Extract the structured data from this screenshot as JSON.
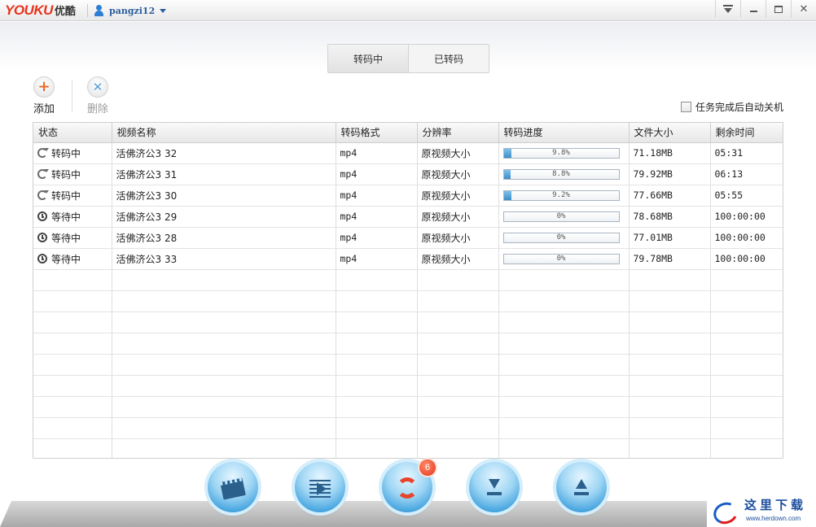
{
  "titlebar": {
    "logo_text": "YOUKU",
    "logo_cn": "优酷",
    "username": "pangzi12"
  },
  "tabs": [
    {
      "label": "转码中",
      "active": true
    },
    {
      "label": "已转码",
      "active": false
    }
  ],
  "toolbar": {
    "add_label": "添加",
    "delete_label": "删除",
    "auto_shutdown_label": "任务完成后自动关机",
    "auto_shutdown_checked": false
  },
  "table": {
    "headers": [
      "状态",
      "视频名称",
      "转码格式",
      "分辨率",
      "转码进度",
      "文件大小",
      "剩余时间"
    ],
    "rows": [
      {
        "status": "转码中",
        "status_icon": "refresh-icon",
        "name": "活佛济公3 32",
        "format": "mp4",
        "resolution": "原视频大小",
        "progress": 9.8,
        "progress_text": "9.8%",
        "size": "71.18MB",
        "remaining": "05:31"
      },
      {
        "status": "转码中",
        "status_icon": "refresh-icon",
        "name": "活佛济公3 31",
        "format": "mp4",
        "resolution": "原视频大小",
        "progress": 8.8,
        "progress_text": "8.8%",
        "size": "79.92MB",
        "remaining": "06:13"
      },
      {
        "status": "转码中",
        "status_icon": "refresh-icon",
        "name": "活佛济公3 30",
        "format": "mp4",
        "resolution": "原视频大小",
        "progress": 9.2,
        "progress_text": "9.2%",
        "size": "77.66MB",
        "remaining": "05:55"
      },
      {
        "status": "等待中",
        "status_icon": "clock-icon",
        "name": "活佛济公3 29",
        "format": "mp4",
        "resolution": "原视频大小",
        "progress": 0,
        "progress_text": "0%",
        "size": "78.68MB",
        "remaining": "100:00:00"
      },
      {
        "status": "等待中",
        "status_icon": "clock-icon",
        "name": "活佛济公3 28",
        "format": "mp4",
        "resolution": "原视频大小",
        "progress": 0,
        "progress_text": "0%",
        "size": "77.01MB",
        "remaining": "100:00:00"
      },
      {
        "status": "等待中",
        "status_icon": "clock-icon",
        "name": "活佛济公3 33",
        "format": "mp4",
        "resolution": "原视频大小",
        "progress": 0,
        "progress_text": "0%",
        "size": "79.78MB",
        "remaining": "100:00:00"
      }
    ]
  },
  "bottom_nav": {
    "items": [
      {
        "name": "video-library-button",
        "icon": "film-icon"
      },
      {
        "name": "playlist-button",
        "icon": "list-icon"
      },
      {
        "name": "convert-button",
        "icon": "convert-icon"
      },
      {
        "name": "download-button",
        "icon": "download-icon"
      },
      {
        "name": "upload-button",
        "icon": "upload-icon"
      }
    ],
    "convert_badge": "6"
  },
  "watermark": {
    "cn": "这里下载",
    "url": "www.herdown.com"
  },
  "colors": {
    "brand_red": "#e8331c",
    "accent_blue": "#2d7fd3",
    "progress_blue": "#3b8fc9"
  }
}
